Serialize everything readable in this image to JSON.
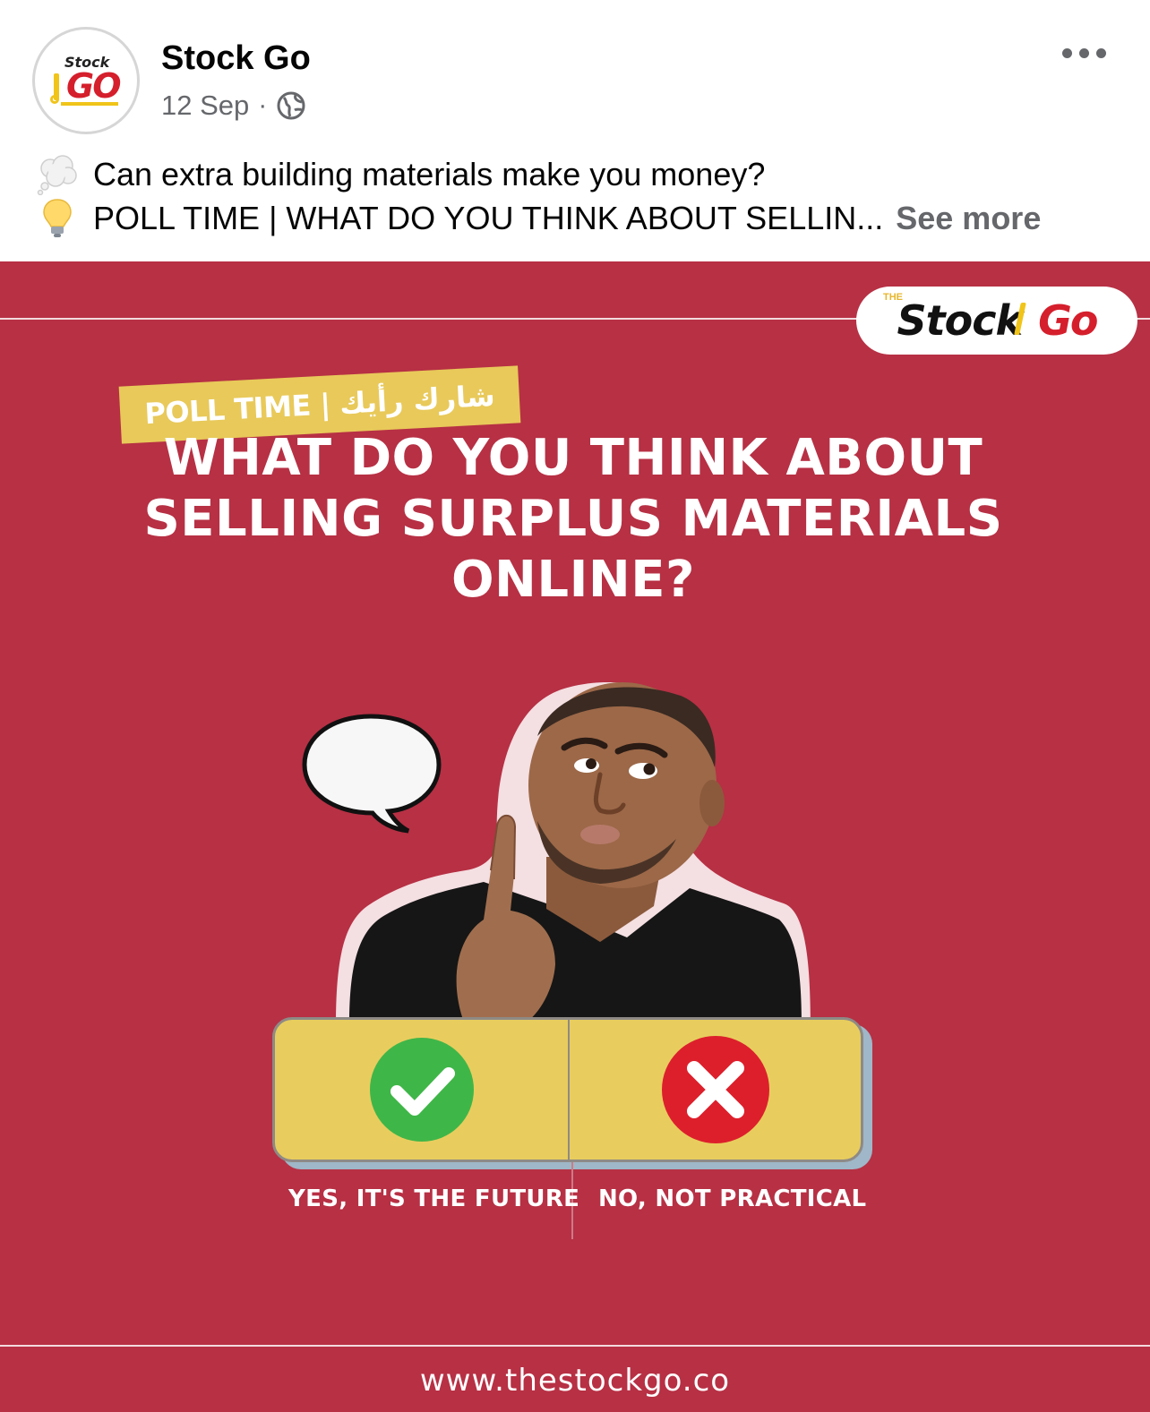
{
  "post": {
    "page_name": "Stock Go",
    "date": "12 Sep",
    "separator": "·",
    "avatar": {
      "word_small": "Stock",
      "word_big": "GO"
    },
    "caption": {
      "line1_text": "Can extra building materials make you money?",
      "line2_text": "POLL TIME | WHAT DO YOU THINK ABOUT SELLIN...",
      "see_more": "See more",
      "line1_icon": "thought-balloon-icon",
      "line2_icon": "light-bulb-icon"
    }
  },
  "image": {
    "brand": {
      "the": "THE",
      "word1": "Stock",
      "word2": "Go"
    },
    "poll_tag": "POLL TIME | شارك رأيك",
    "headline": "WHAT DO YOU THINK ABOUT SELLING SURPLUS MATERIALS ONLINE?",
    "option_yes": "YES, IT'S THE FUTURE",
    "option_no": "NO, NOT PRACTICAL",
    "url": "www.thestockgo.co"
  },
  "colors": {
    "background": "#b73044",
    "accent_yellow": "#e8cd5e",
    "yes_green": "#3fb648",
    "no_red": "#dd1f2c",
    "brand_red": "#d51f2c"
  }
}
